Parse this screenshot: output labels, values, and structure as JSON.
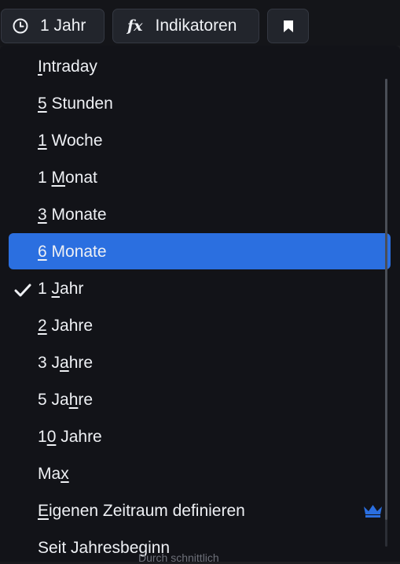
{
  "toolbar": {
    "period_label": "1 Jahr",
    "period_icon": "clock-icon",
    "indicators_icon": "fx",
    "indicators_label": "Indikatoren",
    "bookmark_icon": "bookmark-icon"
  },
  "menu": {
    "selected_index": 5,
    "checked_index": 6,
    "items": [
      {
        "pre": "",
        "u": "I",
        "post": "ntraday"
      },
      {
        "pre": "",
        "u": "5",
        "post": " Stunden"
      },
      {
        "pre": "",
        "u": "1",
        "post": " Woche"
      },
      {
        "pre": "1 ",
        "u": "M",
        "post": "onat"
      },
      {
        "pre": "",
        "u": "3",
        "post": " Monate"
      },
      {
        "pre": "",
        "u": "6",
        "post": " Monate"
      },
      {
        "pre": "1 ",
        "u": "J",
        "post": "ahr"
      },
      {
        "pre": "",
        "u": "2",
        "post": " Jahre"
      },
      {
        "pre": "3 J",
        "u": "a",
        "post": "hre"
      },
      {
        "pre": "5 Ja",
        "u": "h",
        "post": "re"
      },
      {
        "pre": "1",
        "u": "0",
        "post": " Jahre"
      },
      {
        "pre": "Ma",
        "u": "x",
        "post": ""
      },
      {
        "pre": "",
        "u": "E",
        "post": "igenen Zeitraum definieren"
      },
      {
        "pre": "Seit Jahresbeginn",
        "u": "",
        "post": ""
      }
    ],
    "premium_icon": "crown-icon",
    "accent_color": "#2b6fe0"
  },
  "background_text": "Durch schnittlich"
}
